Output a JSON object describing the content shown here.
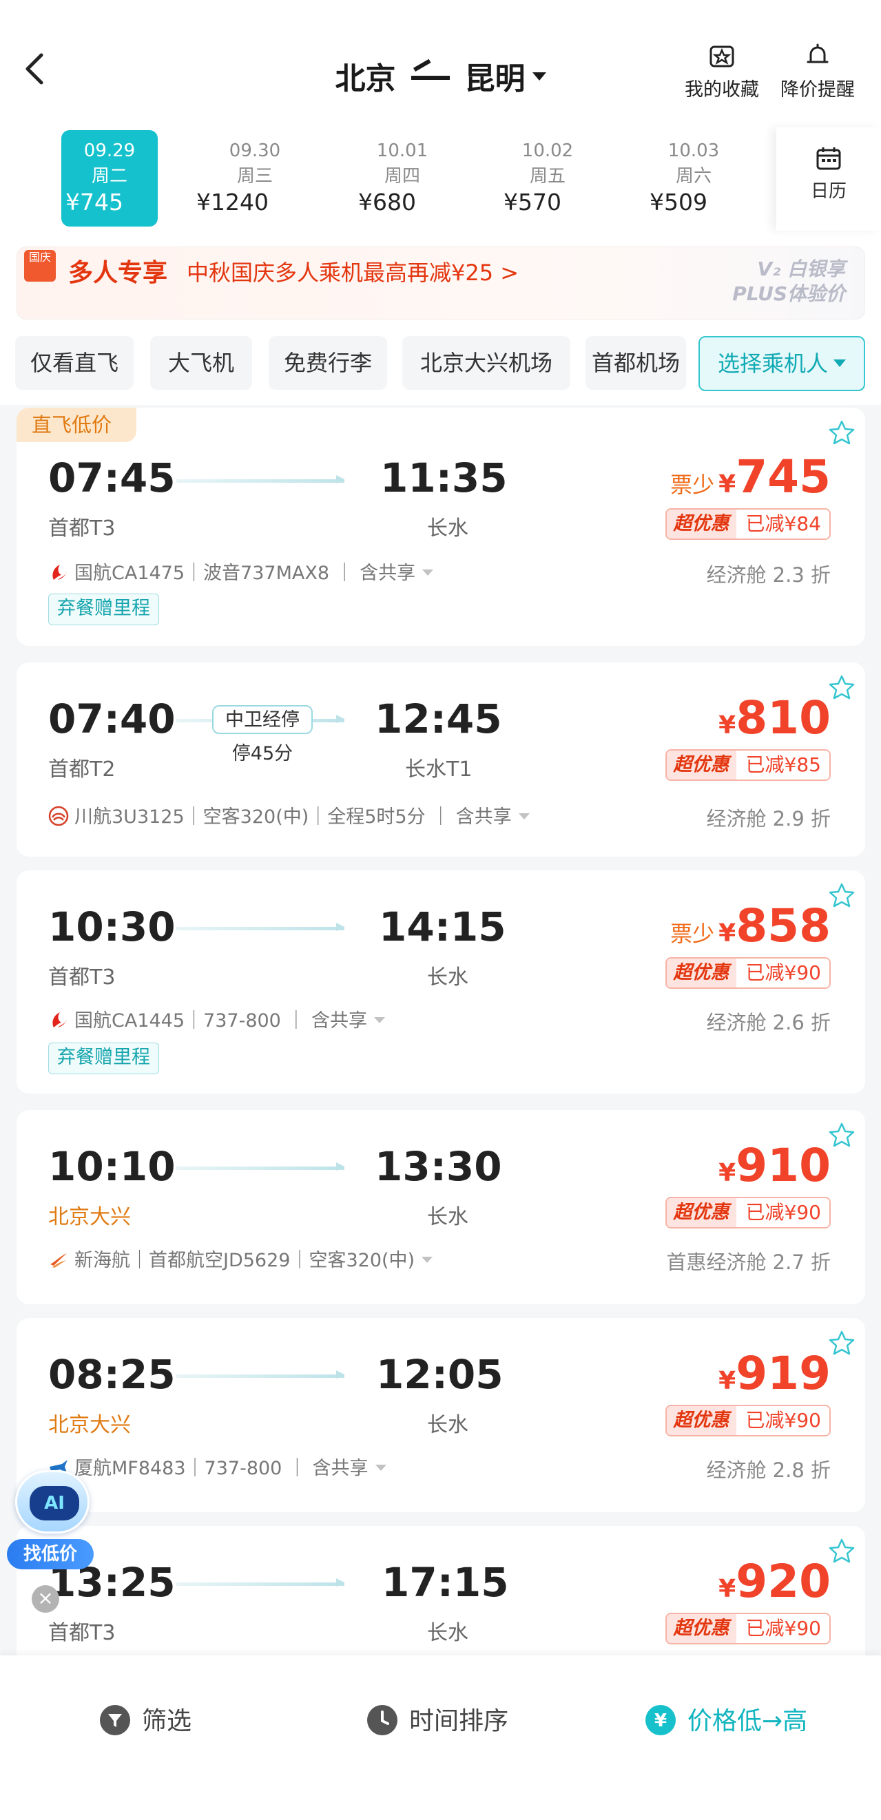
{
  "header": {
    "from": "北京",
    "to": "昆明",
    "favorites_label": "我的收藏",
    "price_alert_label": "降价提醒"
  },
  "dates": [
    {
      "date": "09.29",
      "weekday": "周二",
      "price": "¥745",
      "active": true
    },
    {
      "date": "09.30",
      "weekday": "周三",
      "price": "¥1240"
    },
    {
      "date": "10.01",
      "weekday": "周四",
      "price": "¥680"
    },
    {
      "date": "10.02",
      "weekday": "周五",
      "price": "¥570"
    },
    {
      "date": "10.03",
      "weekday": "周六",
      "price": "¥509"
    }
  ],
  "calendar_label": "日历",
  "promo": {
    "badge": "国庆",
    "title": "多人专享",
    "desc": "中秋国庆多人乘机最高再减¥25 >",
    "right_line1": "V₂ 白银享",
    "right_line2": "PLUS体验价"
  },
  "filters": [
    "仅看直飞",
    "大飞机",
    "免费行李",
    "北京大兴机场",
    "首都机场"
  ],
  "select_passenger": "选择乘机人",
  "flights": [
    {
      "tag": "直飞低价",
      "dep_time": "07:45",
      "arr_time": "11:35",
      "dep_airport": "首都T3",
      "arr_airport": "长水",
      "low_label": "票少",
      "price": "745",
      "super_label": "超优惠",
      "discount": "已减¥84",
      "info": "国航CA1475｜波音737MAX8 ｜ 含共享",
      "cabin": "经济舱 2.3 折",
      "meal_tag": "弃餐赠里程"
    },
    {
      "dep_time": "07:40",
      "arr_time": "12:45",
      "dep_airport": "首都T2",
      "arr_airport": "长水T1",
      "stop": "中卫经停",
      "stop_duration": "停45分",
      "price": "810",
      "super_label": "超优惠",
      "discount": "已减¥85",
      "info": "川航3U3125｜空客320(中)｜全程5时5分 ｜ 含共享",
      "cabin": "经济舱 2.9 折"
    },
    {
      "dep_time": "10:30",
      "arr_time": "14:15",
      "dep_airport": "首都T3",
      "arr_airport": "长水",
      "low_label": "票少",
      "price": "858",
      "super_label": "超优惠",
      "discount": "已减¥90",
      "info": "国航CA1445｜737-800 ｜ 含共享",
      "cabin": "经济舱 2.6 折",
      "meal_tag": "弃餐赠里程"
    },
    {
      "dep_time": "10:10",
      "arr_time": "13:30",
      "dep_airport": "北京大兴",
      "arr_airport": "长水",
      "price": "910",
      "super_label": "超优惠",
      "discount": "已减¥90",
      "info": "新海航｜首都航空JD5629｜空客320(中)",
      "cabin": "首惠经济舱 2.7 折"
    },
    {
      "dep_time": "08:25",
      "arr_time": "12:05",
      "dep_airport": "北京大兴",
      "arr_airport": "长水",
      "price": "919",
      "super_label": "超优惠",
      "discount": "已减¥90",
      "info": "厦航MF8483｜737-800 ｜ 含共享",
      "cabin": "经济舱 2.8 折"
    },
    {
      "dep_time": "13:25",
      "arr_time": "17:15",
      "dep_airport": "首都T3",
      "arr_airport": "长水",
      "price": "920",
      "super_label": "超优惠",
      "discount": "已减¥90"
    }
  ],
  "currency_symbol": "¥",
  "ai": {
    "face": "AI",
    "label": "找低价"
  },
  "bottom": {
    "filter_label": "筛选",
    "time_sort_label": "时间排序",
    "price_sort_label": "价格低→高"
  }
}
